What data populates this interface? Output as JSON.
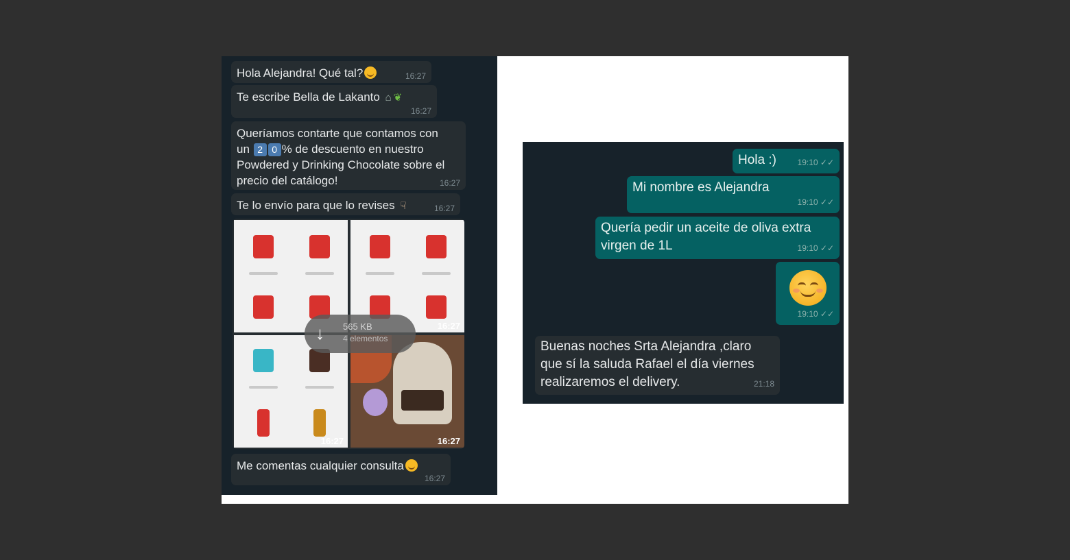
{
  "left_chat": {
    "messages": [
      {
        "text": "Hola Alejandra! Qué tal?",
        "time": "16:27"
      },
      {
        "text": "Te escribe Bella de Lakanto",
        "time": "16:27"
      },
      {
        "line1": "Queríamos contarte que contamos con",
        "line2_pre": "un",
        "digit1": "2",
        "digit2": "0",
        "line2_post": "% de descuento en nuestro",
        "line3": "Powdered y Drinking Chocolate sobre el",
        "line4": "precio del catálogo!",
        "time": "16:27"
      },
      {
        "text": "Te lo envío para que lo revises",
        "time": "16:27"
      },
      {
        "text": "Me comentas cualquier consulta",
        "time": "16:27"
      }
    ],
    "media": {
      "tile_times": [
        "16:27",
        "16:27",
        "16:27"
      ],
      "download_size": "565 KB",
      "download_count": "4 elementos"
    }
  },
  "right_chat": {
    "outgoing": [
      {
        "text": "Hola :)",
        "time": "19:10"
      },
      {
        "text": "Mi nombre es Alejandra",
        "time": "19:10"
      },
      {
        "line1": "Quería pedir un aceite de oliva extra",
        "line2": "virgen de 1L",
        "time": "19:10"
      },
      {
        "time": "19:10"
      }
    ],
    "incoming": {
      "line1": "Buenas noches Srta  Alejandra ,claro",
      "line2": "que sí la saluda Rafael el día viernes",
      "line3": "realizaremos el delivery.",
      "time": "21:18"
    }
  },
  "colors": {
    "chat_bg": "#17222a",
    "incoming_bubble": "#262d31",
    "outgoing_bubble": "#056162",
    "page_bg": "#2f2f2f"
  }
}
